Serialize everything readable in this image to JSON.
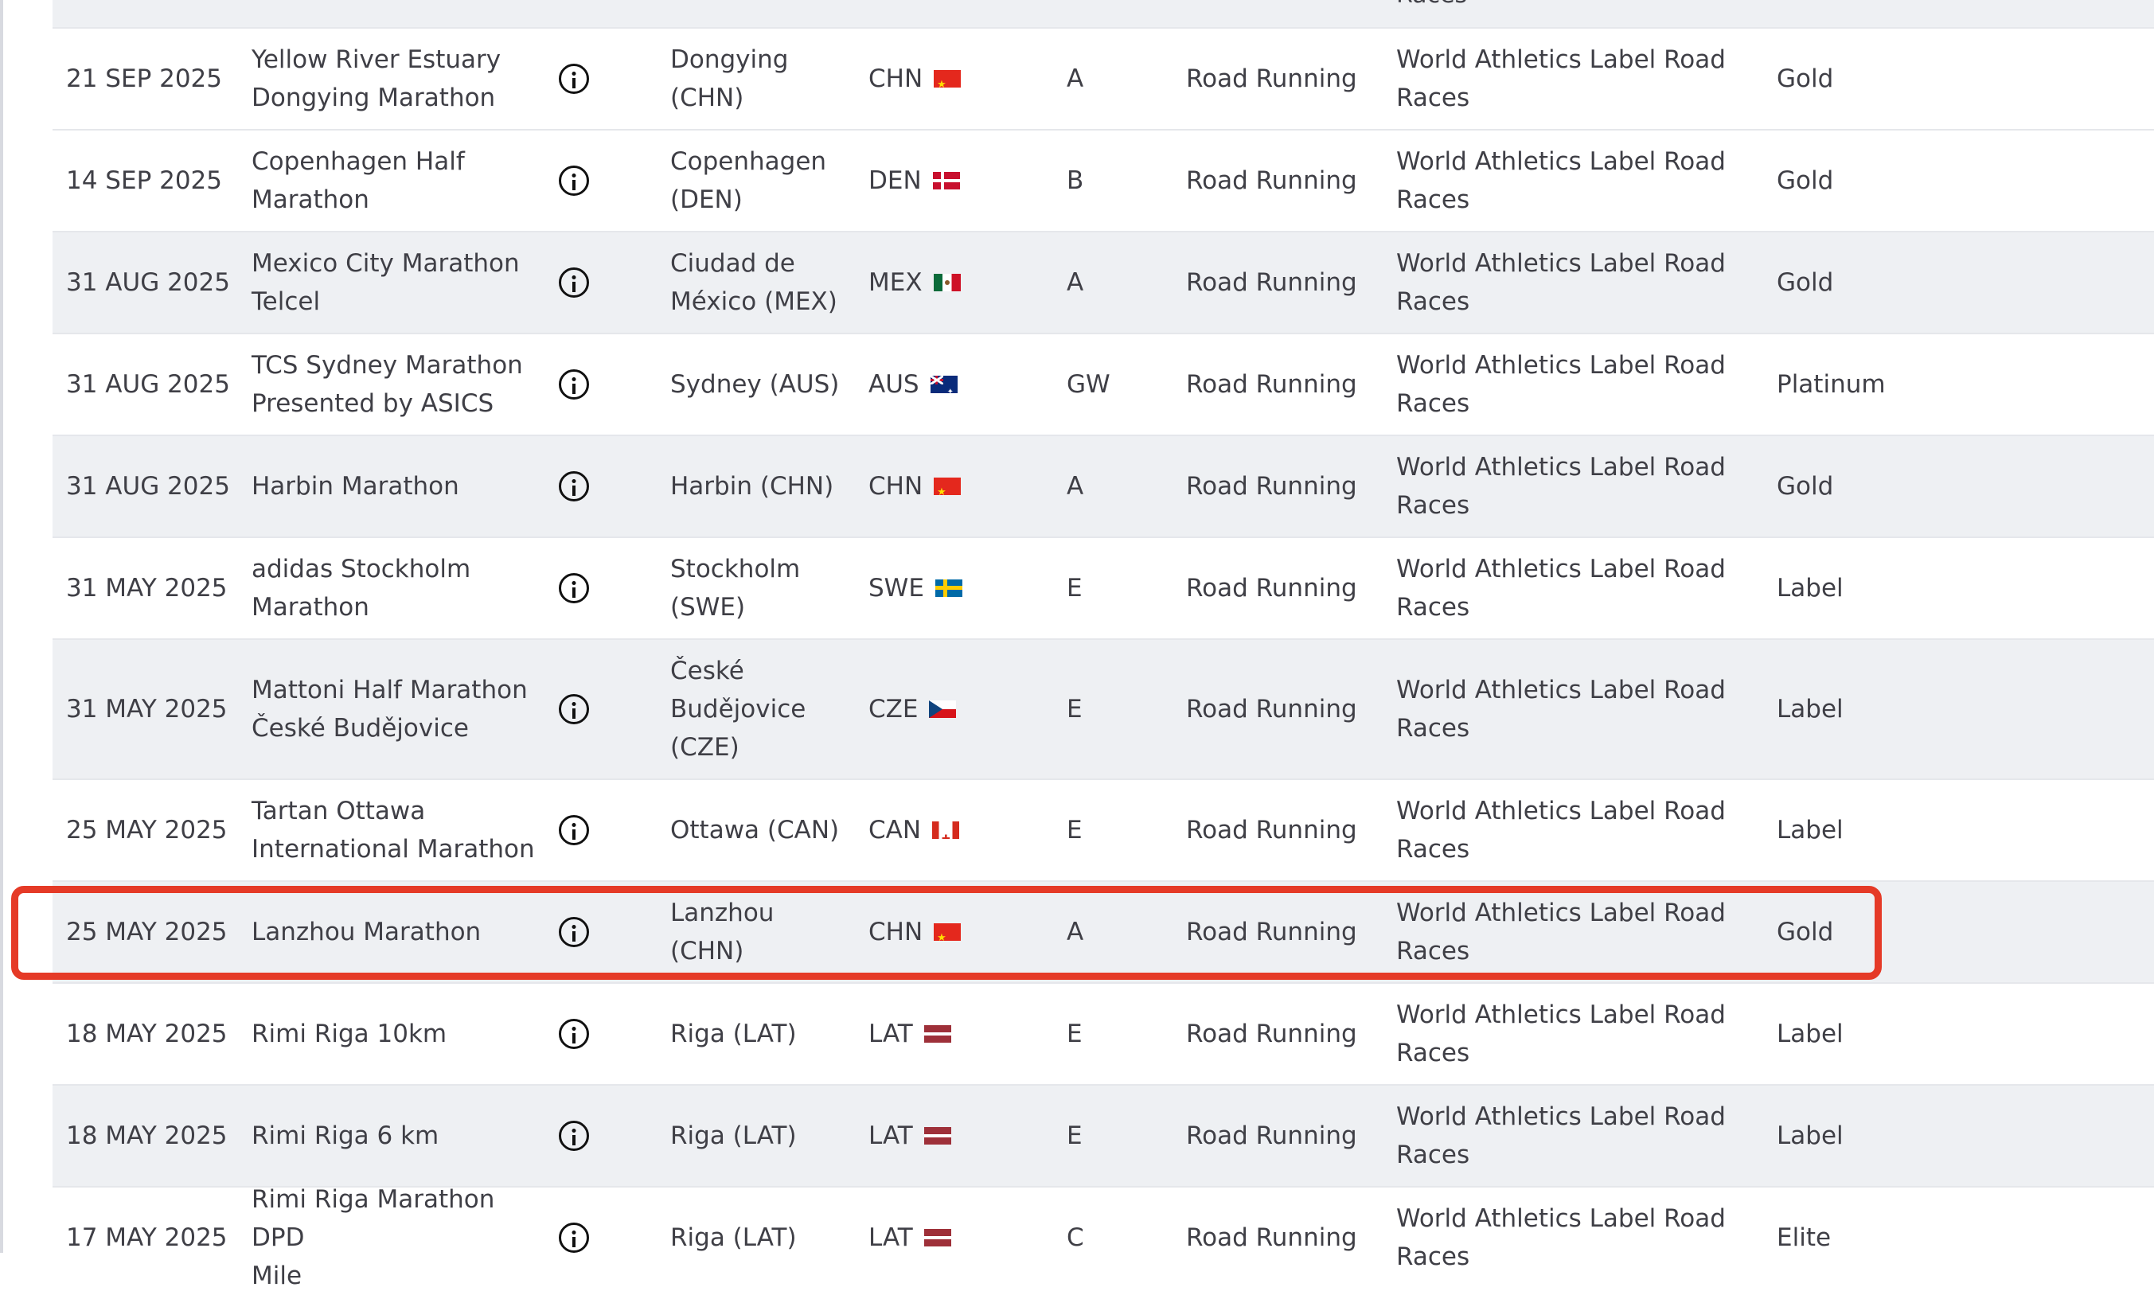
{
  "top_stub": {
    "label_tail": "Races"
  },
  "rows": [
    {
      "date": "21 SEP 2025",
      "name_l1": "Yellow River Estuary",
      "name_l2": "Dongying Marathon",
      "venue_l1": "Dongying",
      "venue_l2": "(CHN)",
      "venue_l3": "",
      "country": "CHN",
      "flag": "chn",
      "category": "A",
      "discipline": "Road Running",
      "label_l1": "World Athletics Label Road",
      "label_l2": "Races",
      "level": "Gold"
    },
    {
      "date": "14 SEP 2025",
      "name_l1": "Copenhagen Half",
      "name_l2": "Marathon",
      "venue_l1": "Copenhagen",
      "venue_l2": "(DEN)",
      "venue_l3": "",
      "country": "DEN",
      "flag": "den",
      "category": "B",
      "discipline": "Road Running",
      "label_l1": "World Athletics Label Road",
      "label_l2": "Races",
      "level": "Gold"
    },
    {
      "date": "31 AUG 2025",
      "name_l1": "Mexico City Marathon",
      "name_l2": "Telcel",
      "venue_l1": "Ciudad de",
      "venue_l2": "México (MEX)",
      "venue_l3": "",
      "country": "MEX",
      "flag": "mex",
      "category": "A",
      "discipline": "Road Running",
      "label_l1": "World Athletics Label Road",
      "label_l2": "Races",
      "level": "Gold"
    },
    {
      "date": "31 AUG 2025",
      "name_l1": "TCS Sydney Marathon",
      "name_l2": "Presented by ASICS",
      "venue_l1": "Sydney (AUS)",
      "venue_l2": "",
      "venue_l3": "",
      "country": "AUS",
      "flag": "aus",
      "category": "GW",
      "discipline": "Road Running",
      "label_l1": "World Athletics Label Road",
      "label_l2": "Races",
      "level": "Platinum"
    },
    {
      "date": "31 AUG 2025",
      "name_l1": "Harbin Marathon",
      "name_l2": "",
      "venue_l1": "Harbin (CHN)",
      "venue_l2": "",
      "venue_l3": "",
      "country": "CHN",
      "flag": "chn",
      "category": "A",
      "discipline": "Road Running",
      "label_l1": "World Athletics Label Road",
      "label_l2": "Races",
      "level": "Gold"
    },
    {
      "date": "31 MAY 2025",
      "name_l1": "adidas Stockholm",
      "name_l2": "Marathon",
      "venue_l1": "Stockholm",
      "venue_l2": "(SWE)",
      "venue_l3": "",
      "country": "SWE",
      "flag": "swe",
      "category": "E",
      "discipline": "Road Running",
      "label_l1": "World Athletics Label Road",
      "label_l2": "Races",
      "level": "Label"
    },
    {
      "date": "31 MAY 2025",
      "name_l1": "Mattoni Half Marathon",
      "name_l2": "České Budějovice",
      "venue_l1": "České",
      "venue_l2": "Budějovice",
      "venue_l3": "(CZE)",
      "country": "CZE",
      "flag": "cze",
      "category": "E",
      "discipline": "Road Running",
      "label_l1": "World Athletics Label Road",
      "label_l2": "Races",
      "level": "Label"
    },
    {
      "date": "25 MAY 2025",
      "name_l1": "Tartan Ottawa",
      "name_l2": "International Marathon",
      "venue_l1": "Ottawa (CAN)",
      "venue_l2": "",
      "venue_l3": "",
      "country": "CAN",
      "flag": "can",
      "category": "E",
      "discipline": "Road Running",
      "label_l1": "World Athletics Label Road",
      "label_l2": "Races",
      "level": "Label"
    },
    {
      "date": "25 MAY 2025",
      "name_l1": "Lanzhou Marathon",
      "name_l2": "",
      "venue_l1": "Lanzhou (CHN)",
      "venue_l2": "",
      "venue_l3": "",
      "country": "CHN",
      "flag": "chn",
      "category": "A",
      "discipline": "Road Running",
      "label_l1": "World Athletics Label Road",
      "label_l2": "Races",
      "level": "Gold",
      "highlighted": true
    },
    {
      "date": "18 MAY 2025",
      "name_l1": "Rimi Riga 10km",
      "name_l2": "",
      "venue_l1": "Riga (LAT)",
      "venue_l2": "",
      "venue_l3": "",
      "country": "LAT",
      "flag": "lat",
      "category": "E",
      "discipline": "Road Running",
      "label_l1": "World Athletics Label Road",
      "label_l2": "Races",
      "level": "Label"
    },
    {
      "date": "18 MAY 2025",
      "name_l1": "Rimi Riga 6 km",
      "name_l2": "",
      "venue_l1": "Riga (LAT)",
      "venue_l2": "",
      "venue_l3": "",
      "country": "LAT",
      "flag": "lat",
      "category": "E",
      "discipline": "Road Running",
      "label_l1": "World Athletics Label Road",
      "label_l2": "Races",
      "level": "Label"
    },
    {
      "date": "17 MAY 2025",
      "name_l1": "Rimi Riga Marathon DPD",
      "name_l2": "Mile",
      "venue_l1": "Riga (LAT)",
      "venue_l2": "",
      "venue_l3": "",
      "country": "LAT",
      "flag": "lat",
      "category": "C",
      "discipline": "Road Running",
      "label_l1": "World Athletics Label Road",
      "label_l2": "Races",
      "level": "Elite"
    }
  ],
  "colors": {
    "row_shaded": "#eef0f3",
    "row_white": "#ffffff",
    "highlight": "#e53a27",
    "text": "#3f3f46"
  }
}
